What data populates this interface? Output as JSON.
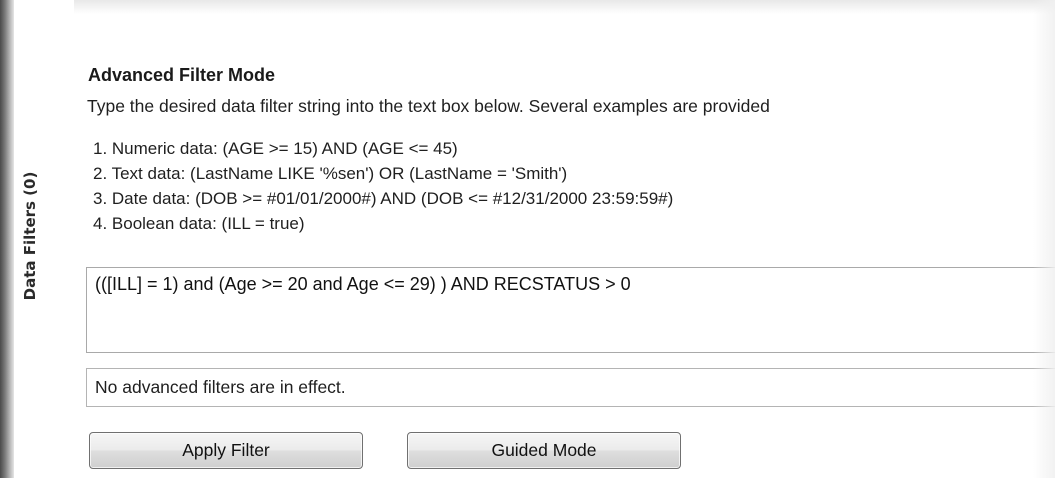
{
  "sidebar": {
    "tab_label": "Data Filters (0)"
  },
  "advanced_filter": {
    "title": "Advanced Filter Mode",
    "description": "Type the desired data filter string into the text box below. Several examples are provided",
    "examples": [
      "1. Numeric data:   (AGE >= 15) AND (AGE <= 45)",
      "2. Text data:   (LastName LIKE '%sen') OR (LastName = 'Smith')",
      "3. Date data:   (DOB >= #01/01/2000#) AND (DOB <= #12/31/2000 23:59:59#)",
      "4. Boolean data:   (ILL = true)"
    ],
    "filter_value": "(([ILL] = 1) and (Age >= 20 and Age <= 29) ) AND  RECSTATUS > 0",
    "status_text": "No advanced filters are in effect."
  },
  "buttons": {
    "apply_label": "Apply Filter",
    "guided_label": "Guided Mode"
  }
}
